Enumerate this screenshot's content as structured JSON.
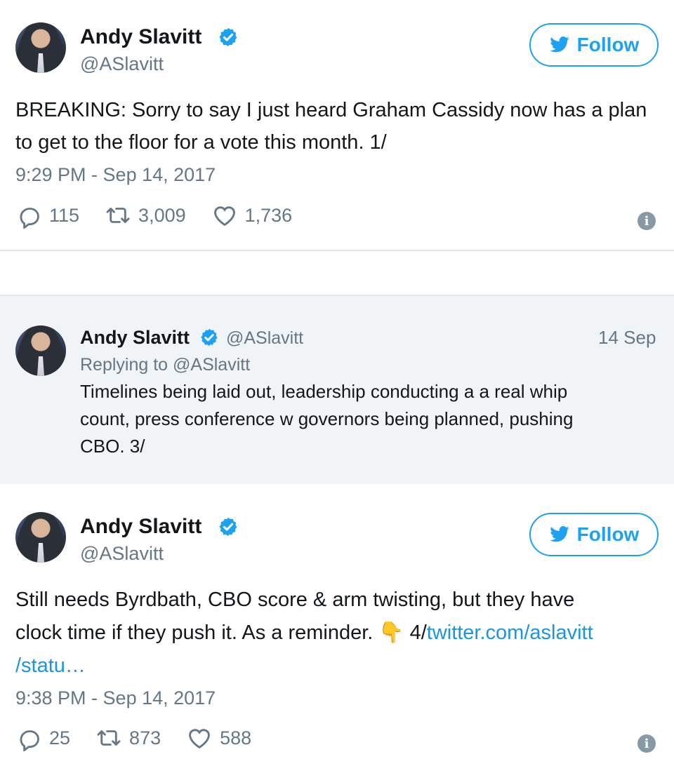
{
  "tweet1": {
    "name": "Andy Slavitt",
    "handle": "@ASlavitt",
    "follow_label": "Follow",
    "text": "BREAKING: Sorry to say I just heard Graham Cassidy now has a plan to get to the floor for a vote this month. 1/",
    "time": "9:29 PM - Sep 14, 2017",
    "replies": "115",
    "retweets": "3,009",
    "likes": "1,736"
  },
  "tweet2": {
    "name": "Andy Slavitt",
    "handle": "@ASlavitt",
    "date": "14 Sep",
    "replying_to": "Replying to @ASlavitt",
    "text_line1": "Timelines being laid out, leadership conducting a a real whip",
    "text_line2": "count, press conference w governors being planned, pushing",
    "text_line3": "CBO. 3/"
  },
  "tweet3": {
    "name": "Andy Slavitt",
    "handle": "@ASlavitt",
    "follow_label": "Follow",
    "text_line1": "Still needs Byrdbath, CBO score & arm twisting, but they have",
    "text_line2_prefix": "clock time if they push it. As a reminder.",
    "emoji": "👇",
    "text_line2_num": "4/",
    "link_part1": "twitter.com/aslavitt",
    "link_part2": "/statu…",
    "time": "9:38 PM - Sep 14, 2017",
    "replies": "25",
    "retweets": "873",
    "likes": "588"
  },
  "colors": {
    "accent": "#1da1f2",
    "muted": "#657786",
    "link": "#1b95e0",
    "quoted_bg": "#f0f4f7"
  },
  "icons": [
    "verified-badge-icon",
    "twitter-bird-icon",
    "reply-icon",
    "retweet-icon",
    "heart-icon",
    "info-icon"
  ]
}
